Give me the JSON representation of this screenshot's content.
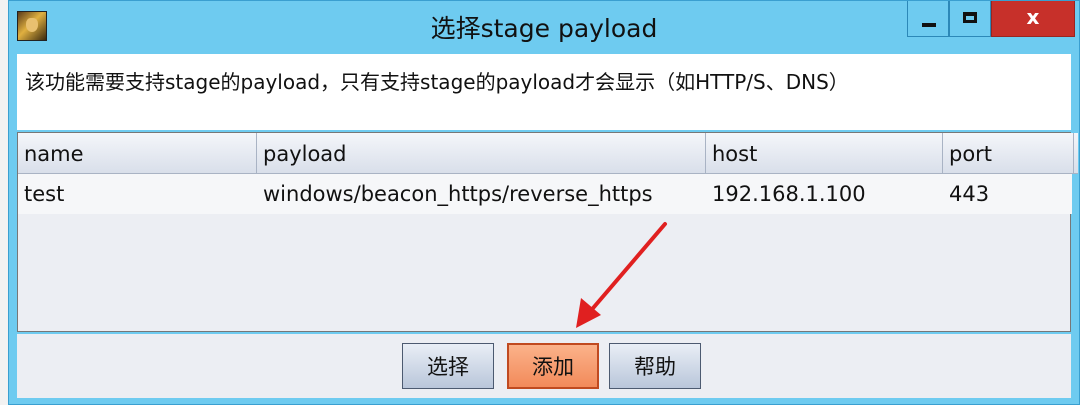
{
  "window": {
    "title": "选择stage payload",
    "close_glyph": "x"
  },
  "description": "该功能需要支持stage的payload，只有支持stage的payload才会显示（如HTTP/S、DNS）",
  "table": {
    "columns": [
      "name",
      "payload",
      "host",
      "port"
    ],
    "rows": [
      {
        "name": "test",
        "payload": "windows/beacon_https/reverse_https",
        "host": "192.168.1.100",
        "port": "443"
      }
    ]
  },
  "buttons": {
    "select": "选择",
    "add": "添加",
    "help": "帮助"
  },
  "colors": {
    "titlebar": "#6ecbf0",
    "close_button": "#c7302a",
    "highlight_button": "#f28a5a",
    "annotation_arrow": "#e02020"
  }
}
